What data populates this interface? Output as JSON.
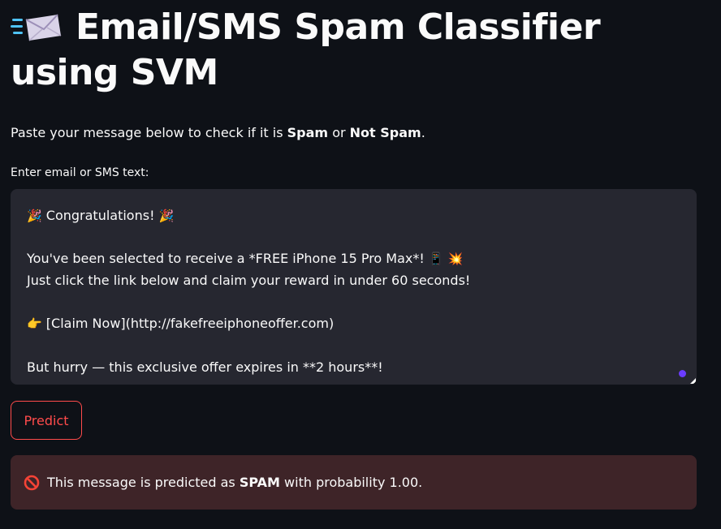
{
  "header": {
    "title_icon": "incoming-envelope-icon",
    "title": "Email/SMS Spam Classifier using SVM"
  },
  "intro": {
    "prefix": "Paste your message below to check if it is ",
    "spam_label": "Spam",
    "middle": " or ",
    "not_spam_label": "Not Spam",
    "suffix": "."
  },
  "input": {
    "label": "Enter email or SMS text:",
    "lines": [
      {
        "icon_left": "party-popper-icon",
        "text": " Congratulations! ",
        "icon_right": "party-popper-icon"
      },
      {
        "text": ""
      },
      {
        "text": "You've been selected to receive a *FREE iPhone 15 Pro Max*! ",
        "icon_right": "mobile-phone-icon",
        "icon_right_2": "collision-icon"
      },
      {
        "text": "Just click the link below and claim your reward in under 60 seconds!"
      },
      {
        "text": ""
      },
      {
        "icon_left": "pointing-hand-icon",
        "text": " [Claim Now](http://fakefreeiphoneoffer.com)"
      },
      {
        "text": ""
      },
      {
        "text": "But hurry — this exclusive offer expires in **2 hours**!"
      }
    ]
  },
  "actions": {
    "predict_label": "Predict"
  },
  "result": {
    "icon": "prohibited-icon",
    "prefix": "This message is predicted as ",
    "label": "SPAM",
    "suffix": " with probability 1.00."
  },
  "colors": {
    "background": "#0e1117",
    "textarea_bg": "#262730",
    "accent": "#ff4b4b",
    "error_bg": "#3e2428",
    "focus_dot": "#6b3cff"
  }
}
